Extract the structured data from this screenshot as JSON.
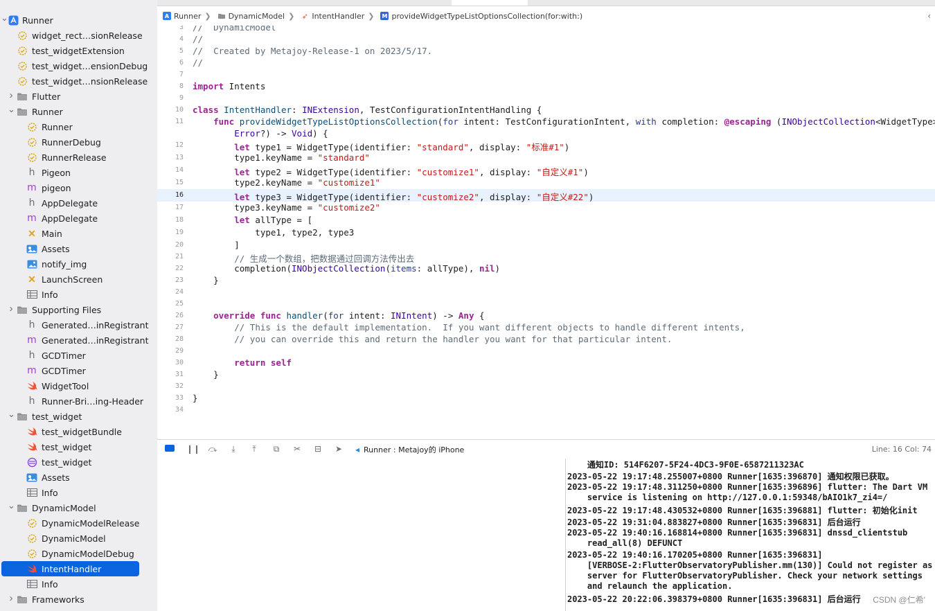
{
  "sidebar": {
    "items": [
      {
        "label": "Runner",
        "icon": "xcode-project-icon",
        "chevron": "down"
      },
      {
        "label": "widget_rect…sionRelease",
        "icon": "xcconfig-gear-icon"
      },
      {
        "label": "test_widgetExtension",
        "icon": "xcconfig-gear-icon"
      },
      {
        "label": "test_widget…ensionDebug",
        "icon": "xcconfig-gear-icon"
      },
      {
        "label": "test_widget…nsionRelease",
        "icon": "xcconfig-gear-icon"
      },
      {
        "label": "Flutter",
        "icon": "folder-icon",
        "chevron": "right"
      },
      {
        "label": "Runner",
        "icon": "folder-icon",
        "chevron": "down"
      },
      {
        "label": "Runner",
        "icon": "xcconfig-gear-icon"
      },
      {
        "label": "RunnerDebug",
        "icon": "xcconfig-gear-icon"
      },
      {
        "label": "RunnerRelease",
        "icon": "xcconfig-gear-icon"
      },
      {
        "label": "Pigeon",
        "icon": "header-h-icon"
      },
      {
        "label": "pigeon",
        "icon": "objc-m-icon"
      },
      {
        "label": "AppDelegate",
        "icon": "header-h-icon"
      },
      {
        "label": "AppDelegate",
        "icon": "objc-m-icon"
      },
      {
        "label": "Main",
        "icon": "storyboard-icon"
      },
      {
        "label": "Assets",
        "icon": "asset-catalog-icon"
      },
      {
        "label": "notify_img",
        "icon": "image-icon"
      },
      {
        "label": "LaunchScreen",
        "icon": "storyboard-icon"
      },
      {
        "label": "Info",
        "icon": "plist-table-icon"
      },
      {
        "label": "Supporting Files",
        "icon": "folder-icon",
        "chevron": "right"
      },
      {
        "label": "Generated…inRegistrant",
        "icon": "header-h-icon"
      },
      {
        "label": "Generated…inRegistrant",
        "icon": "objc-m-icon"
      },
      {
        "label": "GCDTimer",
        "icon": "header-h-icon"
      },
      {
        "label": "GCDTimer",
        "icon": "objc-m-icon"
      },
      {
        "label": "WidgetTool",
        "icon": "swift-icon"
      },
      {
        "label": "Runner-Bri…ing-Header",
        "icon": "header-h-icon"
      },
      {
        "label": "test_widget",
        "icon": "folder-icon",
        "chevron": "down"
      },
      {
        "label": "test_widgetBundle",
        "icon": "swift-icon"
      },
      {
        "label": "test_widget",
        "icon": "swift-icon"
      },
      {
        "label": "test_widget",
        "icon": "intent-definition-icon"
      },
      {
        "label": "Assets",
        "icon": "asset-catalog-icon"
      },
      {
        "label": "Info",
        "icon": "plist-table-icon"
      },
      {
        "label": "DynamicModel",
        "icon": "folder-icon",
        "chevron": "down"
      },
      {
        "label": "DynamicModelRelease",
        "icon": "xcconfig-gear-icon"
      },
      {
        "label": "DynamicModel",
        "icon": "xcconfig-gear-icon"
      },
      {
        "label": "DynamicModelDebug",
        "icon": "xcconfig-gear-icon"
      },
      {
        "label": "IntentHandler",
        "icon": "swift-icon",
        "selected": true
      },
      {
        "label": "Info",
        "icon": "plist-table-icon"
      },
      {
        "label": "Frameworks",
        "icon": "folder-icon",
        "chevron": "right"
      }
    ]
  },
  "jumpbar": {
    "crumbs": [
      "Runner",
      "DynamicModel",
      "IntentHandler",
      "provideWidgetTypeListOptionsCollection(for:with:)"
    ]
  },
  "editor": {
    "current_line": "16",
    "lines": [
      {
        "n": "3",
        "html": "<span class=\"cm\">//  DynamicModel</span>"
      },
      {
        "n": "4",
        "html": "<span class=\"cm\">//</span>"
      },
      {
        "n": "5",
        "html": "<span class=\"cm\">//  Created by Metajoy-Release-1 on 2023/5/17.</span>"
      },
      {
        "n": "6",
        "html": "<span class=\"cm\">//</span>"
      },
      {
        "n": "7",
        "html": ""
      },
      {
        "n": "8",
        "html": "<span class=\"kw\">import</span> Intents"
      },
      {
        "n": "9",
        "html": ""
      },
      {
        "n": "10",
        "html": "<span class=\"kw\">class</span> <span class=\"ty\">IntentHandler</span>: <span class=\"ty2\">INExtension</span>, TestConfigurationIntentHandling {"
      },
      {
        "n": "11",
        "html": "    <span class=\"kw\">func</span> <span class=\"ty\">provideWidgetTypeListOptionsCollection</span>(<span class=\"pm\">for</span> intent: TestConfigurationIntent, <span class=\"pm\">with</span> completion: <span class=\"kw\">@escaping</span> (<span class=\"ty2\">INObjectCollection</span>&lt;WidgetType&gt;?,"
      },
      {
        "n": "",
        "html": "        <span class=\"ty2\">Error</span>?) -&gt; <span class=\"ty2\">Void</span>) {"
      },
      {
        "n": "12",
        "html": "        <span class=\"kw\">let</span> type1 = WidgetType(identifier: <span class=\"st\">\"standard\"</span>, display: <span class=\"st\">\"标准#1\"</span>)"
      },
      {
        "n": "13",
        "html": "        type1.keyName = <span class=\"st\">\"standard\"</span>"
      },
      {
        "n": "14",
        "html": "        <span class=\"kw\">let</span> type2 = WidgetType(identifier: <span class=\"st\">\"customize1\"</span>, display: <span class=\"st\">\"自定义#1\"</span>)"
      },
      {
        "n": "15",
        "html": "        type2.keyName = <span class=\"st\">\"customize1\"</span>"
      },
      {
        "n": "16",
        "html": "        <span class=\"kw\">let</span> type3 = WidgetType(identifier: <span class=\"st\">\"customize2\"</span>, display: <span class=\"st\">\"自定义#22\"</span>)"
      },
      {
        "n": "17",
        "html": "        type3.keyName = <span class=\"st\">\"customize2\"</span>"
      },
      {
        "n": "18",
        "html": "        <span class=\"kw\">let</span> allType = ["
      },
      {
        "n": "19",
        "html": "            type1, type2, type3"
      },
      {
        "n": "20",
        "html": "        ]"
      },
      {
        "n": "21",
        "html": "        <span class=\"cm\">// 生成一个数组，把数据通过回调方法传出去</span>"
      },
      {
        "n": "22",
        "html": "        completion(<span class=\"ty2\">INObjectCollection</span>(<span class=\"pm\">items</span>: allType), <span class=\"kw\">nil</span>)"
      },
      {
        "n": "23",
        "html": "    }"
      },
      {
        "n": "24",
        "html": ""
      },
      {
        "n": "25",
        "html": ""
      },
      {
        "n": "26",
        "html": "    <span class=\"kw\">override</span> <span class=\"kw\">func</span> <span class=\"ty\">handler</span>(<span class=\"pm\">for</span> intent: <span class=\"ty2\">INIntent</span>) -&gt; <span class=\"kw\">Any</span> {"
      },
      {
        "n": "27",
        "html": "        <span class=\"cm\">// This is the default implementation.  If you want different objects to handle different intents,</span>"
      },
      {
        "n": "28",
        "html": "        <span class=\"cm\">// you can override this and return the handler you want for that particular intent.</span>"
      },
      {
        "n": "29",
        "html": ""
      },
      {
        "n": "30",
        "html": "        <span class=\"kw\">return</span> <span class=\"kw\">self</span>"
      },
      {
        "n": "31",
        "html": "    }"
      },
      {
        "n": "32",
        "html": ""
      },
      {
        "n": "33",
        "html": "}"
      },
      {
        "n": "34",
        "html": ""
      }
    ]
  },
  "debugbar": {
    "scheme": "Runner : Metajoy的 iPhone",
    "status": "Line: 16  Col: 74"
  },
  "console": {
    "lines": [
      "    通知ID: 514F6207-5F24-4DC3-9F0E-6587211323AC",
      "2023-05-22 19:17:48.255007+0800 Runner[1635:396870] 通知权限已获取。",
      "2023-05-22 19:17:48.311250+0800 Runner[1635:396896] flutter: The Dart VM",
      "    service is listening on http://127.0.0.1:59348/bAIO1k7_zi4=/",
      "2023-05-22 19:17:48.430532+0800 Runner[1635:396881] flutter: 初始化init",
      "2023-05-22 19:31:04.883827+0800 Runner[1635:396831] 后台运行",
      "2023-05-22 19:40:16.168814+0800 Runner[1635:396831] dnssd_clientstub",
      "    read_all(8) DEFUNCT",
      "2023-05-22 19:40:16.170205+0800 Runner[1635:396831]",
      "    [VERBOSE-2:FlutterObservatoryPublisher.mm(130)] Could not register as",
      "    server for FlutterObservatoryPublisher. Check your network settings",
      "    and relaunch the application.",
      "2023-05-22 20:22:06.398379+0800 Runner[1635:396831] 后台运行"
    ],
    "watermark": "CSDN @仁希'"
  }
}
